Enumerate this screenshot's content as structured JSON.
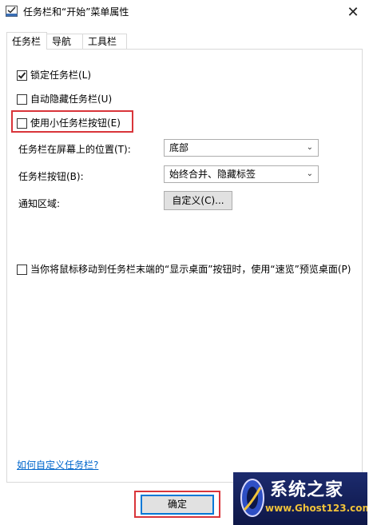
{
  "window": {
    "title": "任务栏和“开始”菜单属性",
    "close_glyph": "✕"
  },
  "tabs": [
    {
      "label": "任务栏",
      "active": true
    },
    {
      "label": "导航",
      "active": false
    },
    {
      "label": "工具栏",
      "active": false
    }
  ],
  "options": {
    "lock_taskbar": {
      "label": "锁定任务栏(L)",
      "checked": true
    },
    "auto_hide": {
      "label": "自动隐藏任务栏(U)",
      "checked": false
    },
    "small_buttons": {
      "label": "使用小任务栏按钮(E)",
      "checked": false
    },
    "peek": {
      "label": "当你将鼠标移动到任务栏末端的“显示桌面”按钮时，使用“速览”预览桌面(P)",
      "checked": false
    }
  },
  "location": {
    "label": "任务栏在屏幕上的位置(T):",
    "value": "底部"
  },
  "buttons_combine": {
    "label": "任务栏按钮(B):",
    "value": "始终合并、隐藏标签"
  },
  "notification": {
    "label": "通知区域:",
    "button": "自定义(C)..."
  },
  "help_link": "如何自定义任务栏?",
  "footer": {
    "ok": "确定"
  },
  "watermark": {
    "name": "系统之家",
    "url": "www.Ghost123.com"
  },
  "colors": {
    "highlight": "#d9353a",
    "link": "#0066cc"
  }
}
